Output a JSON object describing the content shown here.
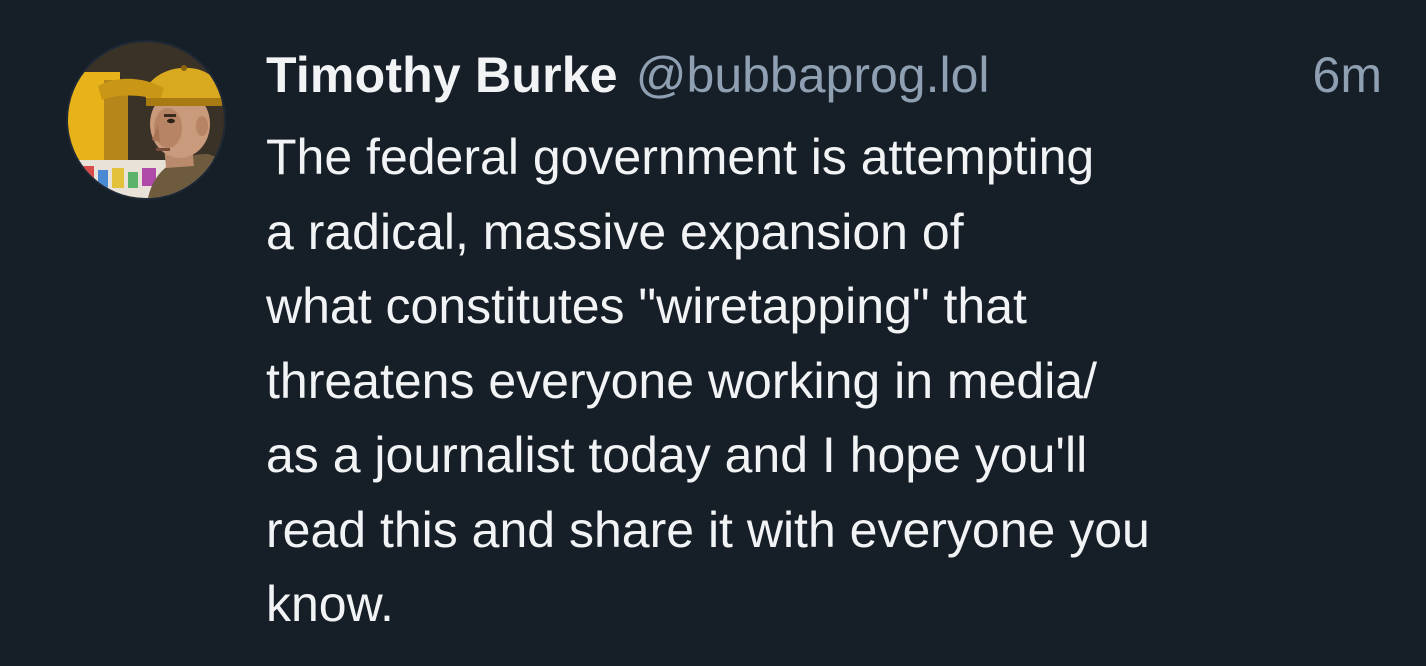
{
  "post": {
    "author": {
      "display_name": "Timothy Burke",
      "handle": "@bubbaprog.lol"
    },
    "timestamp": "6m",
    "text_lines": [
      "The federal government is attempting",
      "a radical, massive expansion of",
      "what constitutes \"wiretapping\" that",
      "threatens everyone working in media/",
      "as a journalist today and I hope you'll",
      "read this and share it with everyone you",
      "know."
    ]
  },
  "colors": {
    "background": "#161e27",
    "text_primary": "#f1f3f5",
    "text_secondary": "#8fa0b2"
  },
  "icons": {
    "avatar": "user-avatar-photo"
  }
}
